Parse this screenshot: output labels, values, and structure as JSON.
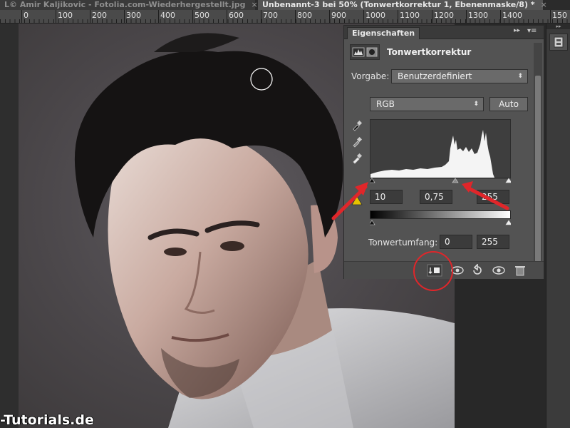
{
  "tabs": {
    "inactive_label": "L© Amir Kaljikovic - Fotolia.com-Wiederhergestellt.jpg",
    "active_label": "Unbenannt-3 bei 50% (Tonwertkorrektur 1, Ebenenmaske/8) *",
    "close_glyph": "×"
  },
  "ruler": {
    "ticks": [
      "0",
      "100",
      "200",
      "300",
      "400",
      "500",
      "600",
      "700",
      "800",
      "900",
      "1000",
      "1100",
      "1200",
      "1300",
      "1400",
      "150"
    ]
  },
  "panel": {
    "tab_label": "Eigenschaften",
    "collapse_glyph": "▸▸",
    "menu_glyph": "▾≡",
    "adjustment_title": "Tonwertkorrektur",
    "preset_label": "Vorgabe:",
    "preset_value": "Benutzerdefiniert",
    "channel_value": "RGB",
    "auto_label": "Auto",
    "input_black": "10",
    "input_gamma": "0,75",
    "input_white": "255",
    "output_label": "Tonwertumfang:",
    "output_black": "0",
    "output_white": "255"
  },
  "watermark": {
    "text": "-Tutorials.de"
  },
  "icons": {
    "histogram_icon": "histogram-icon",
    "mask_icon": "mask-icon",
    "eyedropper_black": "eyedropper-black-icon",
    "eyedropper_gray": "eyedropper-gray-icon",
    "eyedropper_white": "eyedropper-white-icon",
    "clip_to_layer": "clip-to-layer-icon",
    "view_previous": "view-previous-icon",
    "reset": "reset-icon",
    "visibility": "eye-icon",
    "delete": "trash-icon",
    "properties_dock": "properties-icon"
  },
  "colors": {
    "annotation_red": "#e0262a",
    "panel_bg": "#535353",
    "tab_active_bg": "#555555"
  }
}
